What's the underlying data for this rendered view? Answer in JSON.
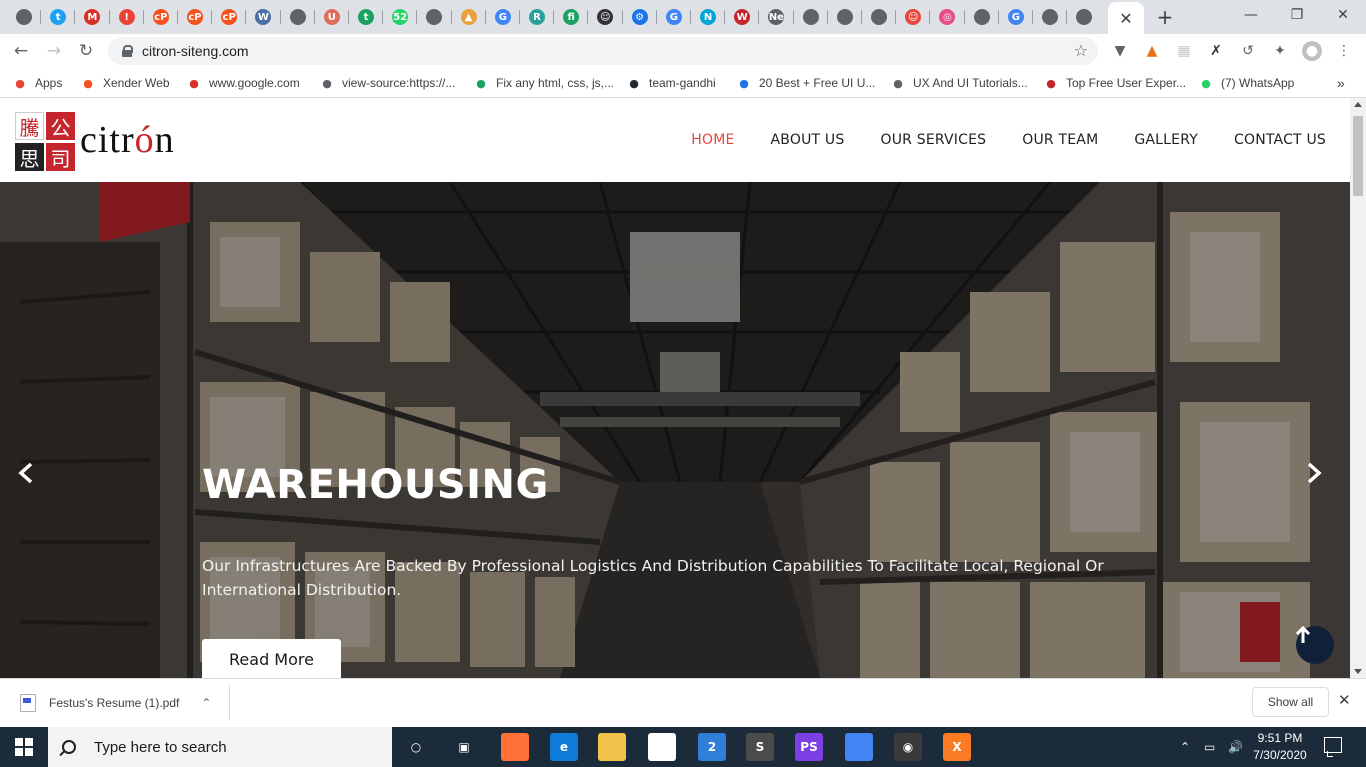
{
  "browser": {
    "tabs": [
      {
        "icon": "globe-icon",
        "color": "#5f6368",
        "glyph": ""
      },
      {
        "icon": "twitter-icon",
        "color": "#1da1f2",
        "glyph": "t"
      },
      {
        "icon": "gmail-icon",
        "color": "#d93025",
        "glyph": "M"
      },
      {
        "icon": "alert-icon",
        "color": "#ea4335",
        "glyph": "!"
      },
      {
        "icon": "cp-icon",
        "color": "#f4511e",
        "glyph": "cP"
      },
      {
        "icon": "cp-icon",
        "color": "#f4511e",
        "glyph": "cP"
      },
      {
        "icon": "cp-icon",
        "color": "#f4511e",
        "glyph": "cP"
      },
      {
        "icon": "document-icon",
        "color": "#4a6fa5",
        "glyph": "W"
      },
      {
        "icon": "globe-icon",
        "color": "#5f6368",
        "glyph": ""
      },
      {
        "icon": "shield-icon",
        "color": "#e06c5a",
        "glyph": "U"
      },
      {
        "icon": "t-icon",
        "color": "#1aa260",
        "glyph": "t"
      },
      {
        "icon": "whatsapp-icon",
        "color": "#25d366",
        "glyph": "52"
      },
      {
        "icon": "globe-icon",
        "color": "#5f6368",
        "glyph": ""
      },
      {
        "icon": "chart-icon",
        "color": "#e8a33b",
        "glyph": "▲"
      },
      {
        "icon": "google-icon",
        "color": "#4285f4",
        "glyph": "G"
      },
      {
        "icon": "r-icon",
        "color": "#2aa198",
        "glyph": "R"
      },
      {
        "icon": "fi-icon",
        "color": "#1aa260",
        "glyph": "fi"
      },
      {
        "icon": "person-icon",
        "color": "#333333",
        "glyph": "☺"
      },
      {
        "icon": "gear-icon",
        "color": "#1a73e8",
        "glyph": "⚙"
      },
      {
        "icon": "google-icon",
        "color": "#4285f4",
        "glyph": "G"
      },
      {
        "icon": "n-icon",
        "color": "#00a6d6",
        "glyph": "N"
      },
      {
        "icon": "wave-icon",
        "color": "#c5262d",
        "glyph": "W"
      },
      {
        "icon": "new-tab-icon",
        "color": "#5f6368",
        "glyph": "Ne"
      },
      {
        "icon": "globe-icon",
        "color": "#5f6368",
        "glyph": ""
      },
      {
        "icon": "globe-icon",
        "color": "#5f6368",
        "glyph": ""
      },
      {
        "icon": "globe-icon",
        "color": "#5f6368",
        "glyph": ""
      },
      {
        "icon": "smile-icon",
        "color": "#e8473d",
        "glyph": "☺"
      },
      {
        "icon": "dribbble-icon",
        "color": "#ea4c89",
        "glyph": "◎"
      },
      {
        "icon": "globe-icon",
        "color": "#5f6368",
        "glyph": ""
      },
      {
        "icon": "google-icon",
        "color": "#4285f4",
        "glyph": "G"
      },
      {
        "icon": "globe-icon",
        "color": "#5f6368",
        "glyph": ""
      },
      {
        "icon": "globe-icon",
        "color": "#5f6368",
        "glyph": ""
      }
    ],
    "active_tab_close": "✕",
    "new_tab": "+",
    "window_controls": {
      "minimize": "—",
      "maximize": "❐",
      "close": "✕"
    },
    "url": "citron-siteng.com"
  },
  "bookmarks": [
    {
      "label": "Apps",
      "icon": "apps-grid-icon",
      "color": "#ea4335"
    },
    {
      "label": "Xender Web",
      "icon": "xender-icon",
      "color": "#f4511e"
    },
    {
      "label": "www.google.com",
      "icon": "gmail-icon",
      "color": "#d93025"
    },
    {
      "label": "view-source:https://...",
      "icon": "globe-icon",
      "color": "#5f6368"
    },
    {
      "label": "Fix any html, css, js,...",
      "icon": "fi-icon",
      "color": "#1aa260"
    },
    {
      "label": "team-gandhi",
      "icon": "github-icon",
      "color": "#24292e"
    },
    {
      "label": "20 Best + Free UI U...",
      "icon": "dd-icon",
      "color": "#1a73e8"
    },
    {
      "label": "UX And UI Tutorials...",
      "icon": "globe-icon",
      "color": "#5f6368"
    },
    {
      "label": "Top Free User Exper...",
      "icon": "ux-icon",
      "color": "#c5262d"
    },
    {
      "label": "(7) WhatsApp",
      "icon": "whatsapp-icon",
      "color": "#25d366"
    }
  ],
  "site": {
    "logo": {
      "chars": [
        "騰",
        "公",
        "思",
        "司"
      ],
      "word_start": "citr",
      "word_accent": "ó",
      "word_end": "n",
      "brand_red": "#c5262d",
      "brand_dark": "#222222"
    },
    "nav": [
      {
        "label": "HOME",
        "active": true
      },
      {
        "label": "ABOUT US",
        "active": false
      },
      {
        "label": "OUR SERVICES",
        "active": false
      },
      {
        "label": "OUR TEAM",
        "active": false
      },
      {
        "label": "GALLERY",
        "active": false
      },
      {
        "label": "CONTACT US",
        "active": false
      }
    ],
    "nav_active_color": "#e8473d",
    "hero": {
      "title": "WAREHOUSING",
      "text": "Our Infrastructures Are Backed By Professional Logistics And Distribution Capabilities To Facilitate Local, Regional Or International Distribution.",
      "button": "Read More",
      "prev_icon": "chevron-left-icon",
      "next_icon": "chevron-right-icon",
      "to_top_icon": "arrow-up-icon"
    }
  },
  "downloads": {
    "file_name": "Festus's Resume (1).pdf",
    "show_all": "Show all",
    "close": "✕"
  },
  "taskbar": {
    "search_placeholder": "Type here to search",
    "apps": [
      {
        "icon": "cortana-icon",
        "color": "transparent",
        "glyph": "○"
      },
      {
        "icon": "task-view-icon",
        "color": "transparent",
        "glyph": "▣"
      },
      {
        "icon": "firefox-icon",
        "color": "#ff7139",
        "glyph": ""
      },
      {
        "icon": "edge-icon",
        "color": "#0f7bd8",
        "glyph": "e"
      },
      {
        "icon": "file-explorer-icon",
        "color": "#f2c34b",
        "glyph": ""
      },
      {
        "icon": "store-icon",
        "color": "#ffffff",
        "glyph": ""
      },
      {
        "icon": "mail-icon",
        "color": "#2f7ed8",
        "glyph": "2"
      },
      {
        "icon": "sublime-icon",
        "color": "#4b4b4b",
        "glyph": "S"
      },
      {
        "icon": "phpstorm-icon",
        "color": "#7b3fe4",
        "glyph": "PS"
      },
      {
        "icon": "chrome-icon",
        "color": "#4285f4",
        "glyph": ""
      },
      {
        "icon": "obs-icon",
        "color": "#3a3a3a",
        "glyph": "◉"
      },
      {
        "icon": "xampp-icon",
        "color": "#fb7a24",
        "glyph": "X"
      }
    ],
    "time": "9:51 PM",
    "date": "7/30/2020"
  }
}
